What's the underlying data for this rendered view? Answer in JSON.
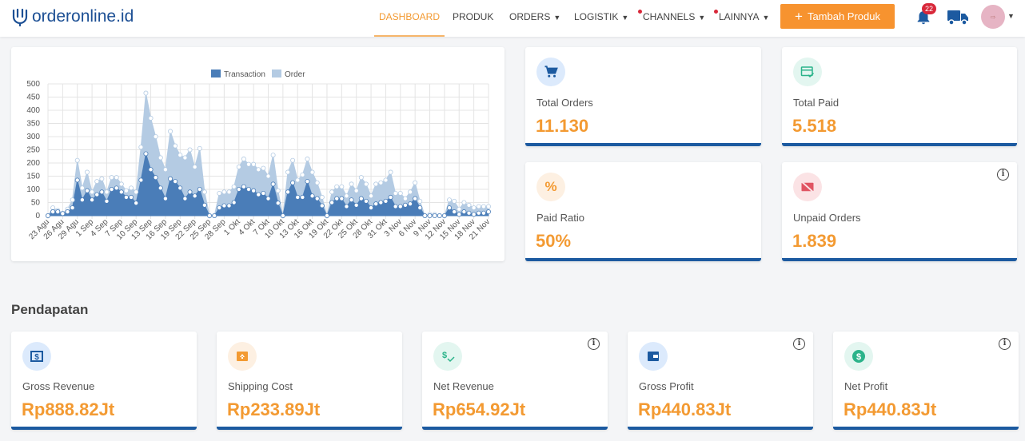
{
  "header": {
    "logo": "orderonline.id",
    "nav": [
      {
        "label": "DASHBOARD"
      },
      {
        "label": "PRODUK"
      },
      {
        "label": "ORDERS"
      },
      {
        "label": "LOGISTIK"
      },
      {
        "label": "CHANNELS"
      },
      {
        "label": "LAINNYA"
      }
    ],
    "add_button": "Tambah Produk",
    "notification_count": "22"
  },
  "stats": [
    {
      "label": "Total Orders",
      "value": "11.130",
      "icon": "cart-icon"
    },
    {
      "label": "Total Paid",
      "value": "5.518",
      "icon": "card-check-icon"
    },
    {
      "label": "Paid Ratio",
      "value": "50%",
      "icon": "percent-icon"
    },
    {
      "label": "Unpaid Orders",
      "value": "1.839",
      "icon": "card-off-icon"
    }
  ],
  "revenue": {
    "title": "Pendapatan",
    "cards": [
      {
        "label": "Gross Revenue",
        "value": "Rp888.82Jt",
        "icon": "dollar-box-icon"
      },
      {
        "label": "Shipping Cost",
        "value": "Rp233.89Jt",
        "icon": "box-up-icon"
      },
      {
        "label": "Net Revenue",
        "value": "Rp654.92Jt",
        "icon": "dollar-check-icon"
      },
      {
        "label": "Gross Profit",
        "value": "Rp440.83Jt",
        "icon": "wallet-icon"
      },
      {
        "label": "Net Profit",
        "value": "Rp440.83Jt",
        "icon": "coin-icon"
      }
    ]
  },
  "colors": {
    "accent": "#f7932f",
    "primary": "#1c5aa0",
    "transaction": "#4a7db8",
    "order": "#b4cbe3"
  },
  "chart_data": {
    "type": "area",
    "title": "",
    "ylim": [
      0,
      500
    ],
    "yticks": [
      0,
      50,
      100,
      150,
      200,
      250,
      300,
      350,
      400,
      450,
      500
    ],
    "x_tick_labels": [
      "23 Agu",
      "26 Agu",
      "29 Agu",
      "1 Sep",
      "4 Sep",
      "7 Sep",
      "10 Sep",
      "13 Sep",
      "16 Sep",
      "19 Sep",
      "22 Sep",
      "25 Sep",
      "28 Sep",
      "1 Okt",
      "4 Okt",
      "7 Okt",
      "10 Okt",
      "13 Okt",
      "16 Okt",
      "19 Okt",
      "22 Okt",
      "25 Okt",
      "28 Okt",
      "31 Okt",
      "3 Nov",
      "6 Nov",
      "9 Nov",
      "12 Nov",
      "15 Nov",
      "18 Nov",
      "21 Nov"
    ],
    "tick_every_days": 3,
    "legend": "top-center",
    "series": [
      {
        "name": "Transaction",
        "values": [
          0,
          15,
          15,
          8,
          15,
          30,
          135,
          60,
          95,
          60,
          80,
          90,
          55,
          100,
          105,
          90,
          70,
          70,
          48,
          135,
          235,
          175,
          145,
          105,
          65,
          140,
          130,
          105,
          65,
          90,
          75,
          100,
          40,
          0,
          0,
          30,
          38,
          38,
          50,
          100,
          110,
          100,
          95,
          80,
          85,
          65,
          120,
          48,
          0,
          90,
          125,
          70,
          70,
          130,
          75,
          65,
          38,
          0,
          50,
          65,
          65,
          35,
          60,
          40,
          65,
          55,
          30,
          45,
          50,
          55,
          70,
          35,
          35,
          40,
          45,
          65,
          30,
          0,
          0,
          0,
          0,
          0,
          30,
          15,
          5,
          15,
          10,
          5,
          10,
          10,
          15
        ]
      },
      {
        "name": "Order",
        "values": [
          0,
          30,
          20,
          10,
          25,
          60,
          210,
          105,
          165,
          90,
          130,
          140,
          90,
          145,
          145,
          120,
          95,
          105,
          90,
          260,
          465,
          370,
          300,
          220,
          175,
          320,
          265,
          230,
          220,
          250,
          185,
          255,
          90,
          0,
          0,
          85,
          90,
          90,
          110,
          185,
          215,
          195,
          195,
          175,
          180,
          150,
          230,
          95,
          0,
          165,
          210,
          135,
          155,
          215,
          165,
          125,
          70,
          0,
          90,
          110,
          110,
          75,
          120,
          95,
          145,
          120,
          75,
          120,
          125,
          135,
          165,
          85,
          85,
          65,
          90,
          125,
          55,
          0,
          5,
          5,
          0,
          0,
          60,
          55,
          25,
          50,
          40,
          30,
          35,
          35,
          35
        ]
      }
    ]
  }
}
